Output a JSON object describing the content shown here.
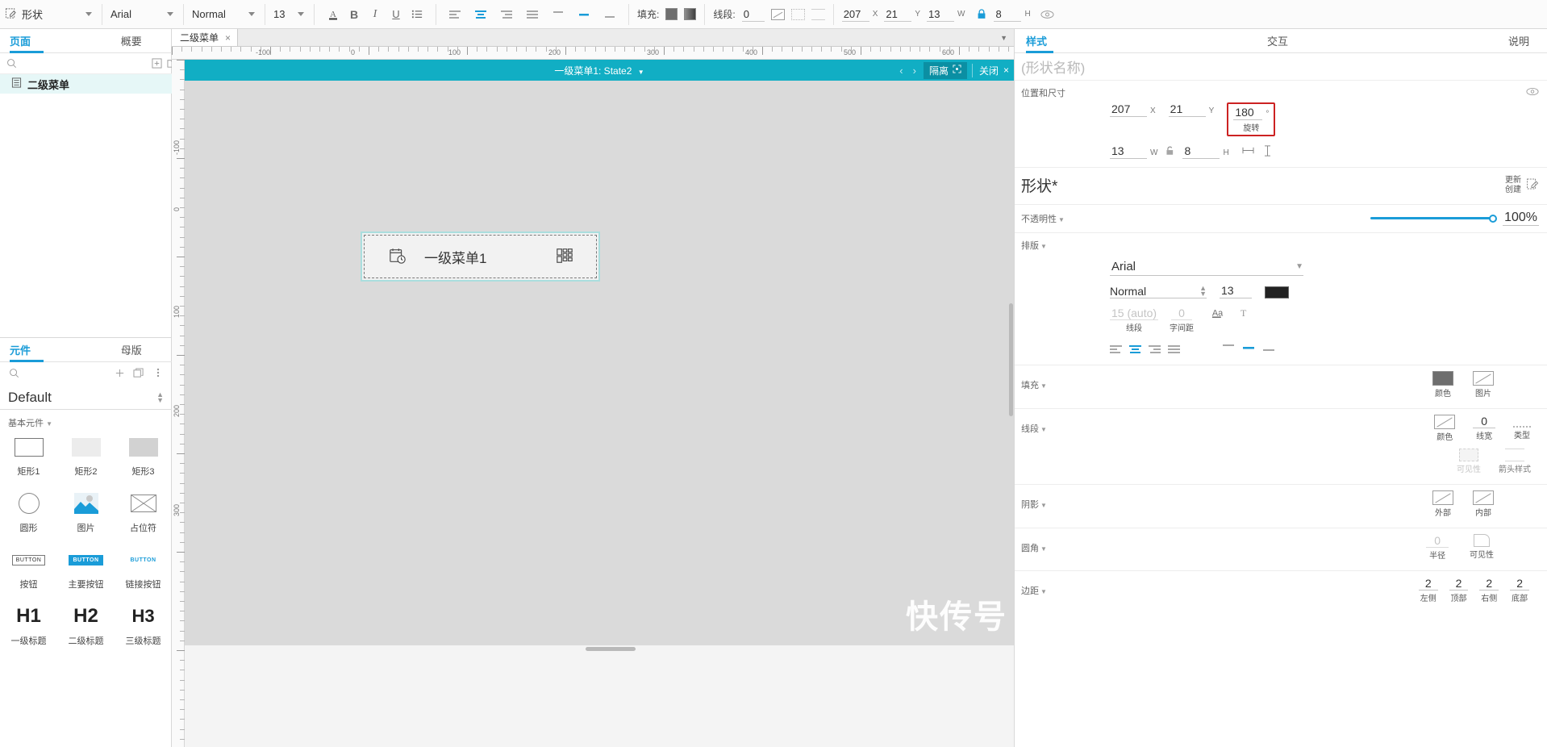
{
  "toolbar": {
    "shape_label": "形状",
    "font_family": "Arial",
    "font_weight": "Normal",
    "font_size": "13",
    "icons": [
      "text-color-icon",
      "bold-icon",
      "italic-icon",
      "underline-icon",
      "list-icon",
      "align-left-icon",
      "align-center-icon",
      "align-right-icon",
      "align-justify-icon",
      "valign-top-icon",
      "valign-middle-icon",
      "valign-bottom-icon"
    ],
    "fill_label": "填充:",
    "line_label": "线段:",
    "line_width": "0",
    "x_value": "207",
    "x_label": "X",
    "y_value": "21",
    "y_label": "Y",
    "w_value": "13",
    "w_label": "W",
    "h_value": "8",
    "h_label": "H",
    "lock_icon": "lock-icon",
    "eye_icon": "eye-icon"
  },
  "left_panel": {
    "top_tabs": [
      {
        "label": "页面",
        "active": true
      },
      {
        "label": "概要",
        "active": false
      }
    ],
    "search_placeholder": "",
    "page_tree": [
      {
        "label": "二级菜单",
        "icon": "page-icon",
        "selected": true
      }
    ],
    "bottom_tabs": [
      {
        "label": "元件",
        "active": true
      },
      {
        "label": "母版",
        "active": false
      }
    ],
    "library_name": "Default",
    "section_title": "基本元件",
    "widgets": [
      {
        "label": "矩形1",
        "icon": "rect-outline-icon"
      },
      {
        "label": "矩形2",
        "icon": "rect-light-icon"
      },
      {
        "label": "矩形3",
        "icon": "rect-gray-icon"
      },
      {
        "label": "圆形",
        "icon": "circle-icon"
      },
      {
        "label": "图片",
        "icon": "image-icon"
      },
      {
        "label": "占位符",
        "icon": "placeholder-icon"
      },
      {
        "label": "按钮",
        "icon": "button-icon",
        "thumb": "BUTTON"
      },
      {
        "label": "主要按钮",
        "icon": "primary-button-icon",
        "thumb": "BUTTON"
      },
      {
        "label": "链接按钮",
        "icon": "link-button-icon",
        "thumb": "BUTTON"
      },
      {
        "label": "一级标题",
        "icon": "h1-icon",
        "thumb": "H1"
      },
      {
        "label": "二级标题",
        "icon": "h2-icon",
        "thumb": "H2"
      },
      {
        "label": "三级标题",
        "icon": "h3-icon",
        "thumb": "H3"
      }
    ]
  },
  "center": {
    "doc_tab": "二级菜单",
    "isolation_bar": {
      "title": "一级菜单1: State2",
      "isolate_label": "隔离",
      "close_label": "关闭"
    },
    "ruler_top_labels": [
      "-100",
      "0",
      "100",
      "200",
      "300",
      "400",
      "500",
      "600"
    ],
    "ruler_left_labels": [
      "-100",
      "0",
      "100",
      "200",
      "300"
    ],
    "widget": {
      "label": "一级菜单1",
      "left_icon": "calendar-clock-icon",
      "right_icon": "grid-apps-icon"
    },
    "watermark": "快传号"
  },
  "right_panel": {
    "tabs": [
      {
        "label": "样式",
        "active": true
      },
      {
        "label": "交互",
        "active": false
      },
      {
        "label": "说明",
        "active": false
      }
    ],
    "shape_name_placeholder": "(形状名称)",
    "position_size": {
      "title": "位置和尺寸",
      "eye_icon": "eye-icon",
      "x": "207",
      "x_label": "X",
      "y": "21",
      "y_label": "Y",
      "rotation": "180",
      "rotation_unit": "°",
      "rotation_label": "旋转",
      "w": "13",
      "w_label": "W",
      "h": "8",
      "h_label": "H",
      "lock_icon": "unlock-icon",
      "fit_width_icon": "fit-width-icon",
      "fit_height_icon": "fit-height-icon",
      "highlight_color": "#cc2222"
    },
    "shape_section": {
      "title": "形状*",
      "update_label": "更新",
      "create_label": "创建",
      "edit_icon": "edit-style-icon"
    },
    "opacity": {
      "title": "不透明性",
      "value": "100%",
      "slider_percent": 100
    },
    "typography": {
      "title": "排版",
      "font_family": "Arial",
      "font_weight": "Normal",
      "font_size": "13",
      "color_swatch": "#222222",
      "line_spacing_value": "15 (auto)",
      "line_spacing_label": "线段",
      "letter_spacing_value": "0",
      "letter_spacing_label": "字间距",
      "case_icon": "text-case-icon",
      "decoration_icon": "text-decoration-icon",
      "h_align": [
        "align-left-icon",
        "align-center-icon",
        "align-right-icon",
        "align-justify-icon"
      ],
      "h_align_active": 1,
      "v_align": [
        "valign-top-icon",
        "valign-middle-icon",
        "valign-bottom-icon"
      ],
      "v_align_active": 1
    },
    "fill": {
      "title": "填充",
      "color_label": "颜色",
      "color_value": "#6e6e6e",
      "image_label": "图片"
    },
    "line": {
      "title": "线段",
      "color_label": "颜色",
      "width_label": "线宽",
      "width_value": "0",
      "type_label": "类型",
      "visibility_label": "可见性",
      "arrow_label": "箭头样式"
    },
    "shadow": {
      "title": "阴影",
      "outer_label": "外部",
      "inner_label": "内部"
    },
    "corner": {
      "title": "圆角",
      "radius_label": "半径",
      "radius_value": "0",
      "visibility_label": "可见性"
    },
    "padding": {
      "title": "边距",
      "values": [
        "2",
        "2",
        "2",
        "2"
      ],
      "labels": [
        "左侧",
        "顶部",
        "右侧",
        "底部"
      ]
    }
  }
}
